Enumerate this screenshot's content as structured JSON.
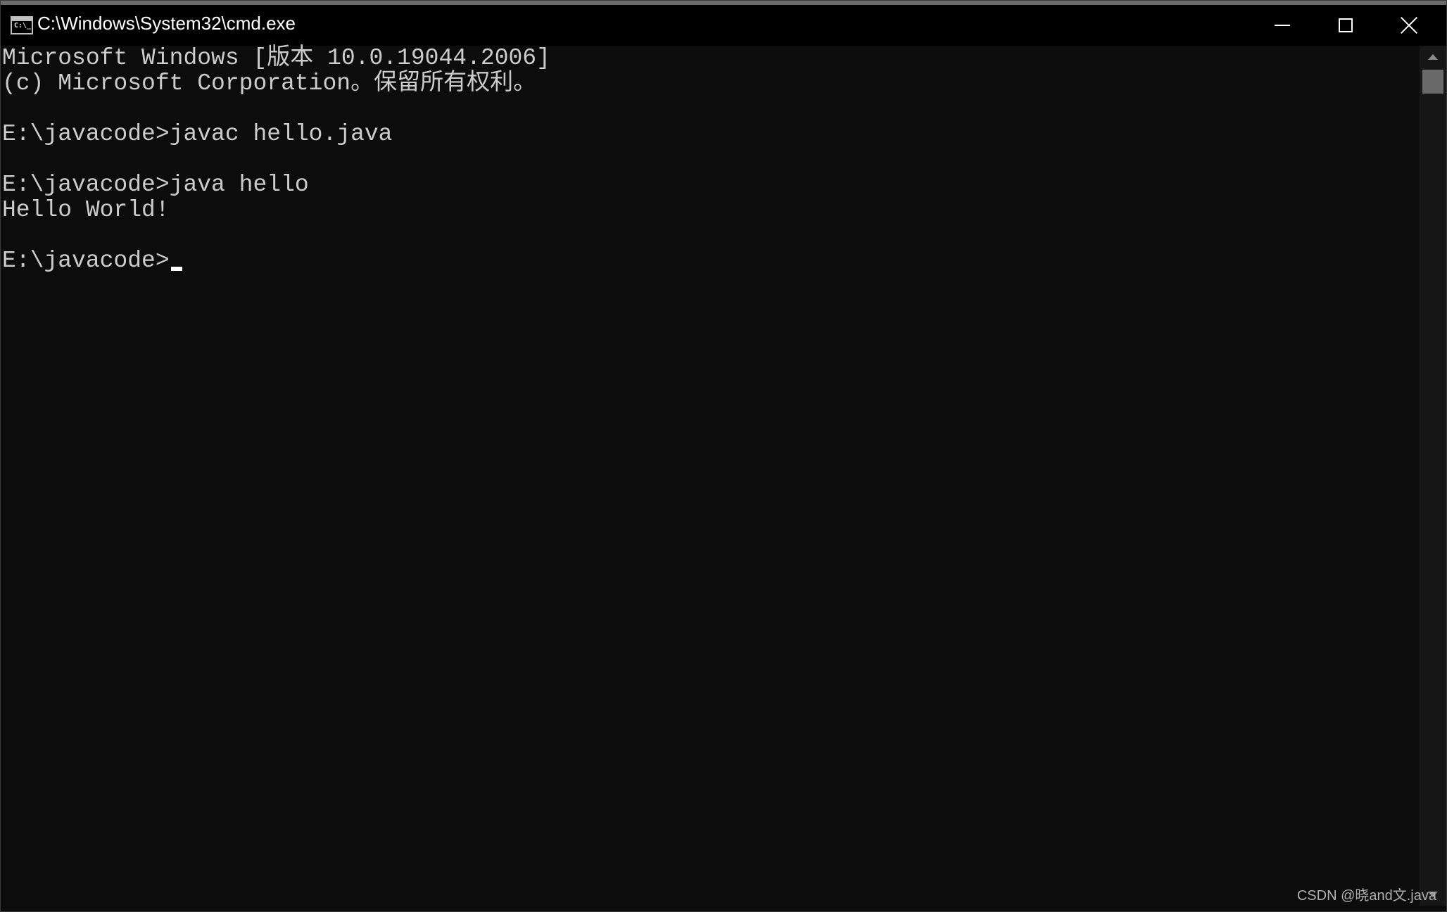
{
  "window": {
    "title": "C:\\Windows\\System32\\cmd.exe",
    "icon_label": "C:\\_",
    "buttons": {
      "minimize": "minimize-icon",
      "maximize": "maximize-icon",
      "close": "close-icon"
    }
  },
  "console": {
    "lines": [
      "Microsoft Windows [版本 10.0.19044.2006]",
      "(c) Microsoft Corporation。保留所有权利。",
      "",
      "E:\\javacode>javac hello.java",
      "",
      "E:\\javacode>java hello",
      "Hello World!",
      "",
      "E:\\javacode>"
    ]
  },
  "watermark": "CSDN @晓and文.java",
  "colors": {
    "background": "#0c0c0c",
    "text": "#cccccc",
    "titlebar": "#000000",
    "title_text": "#ffffff"
  }
}
